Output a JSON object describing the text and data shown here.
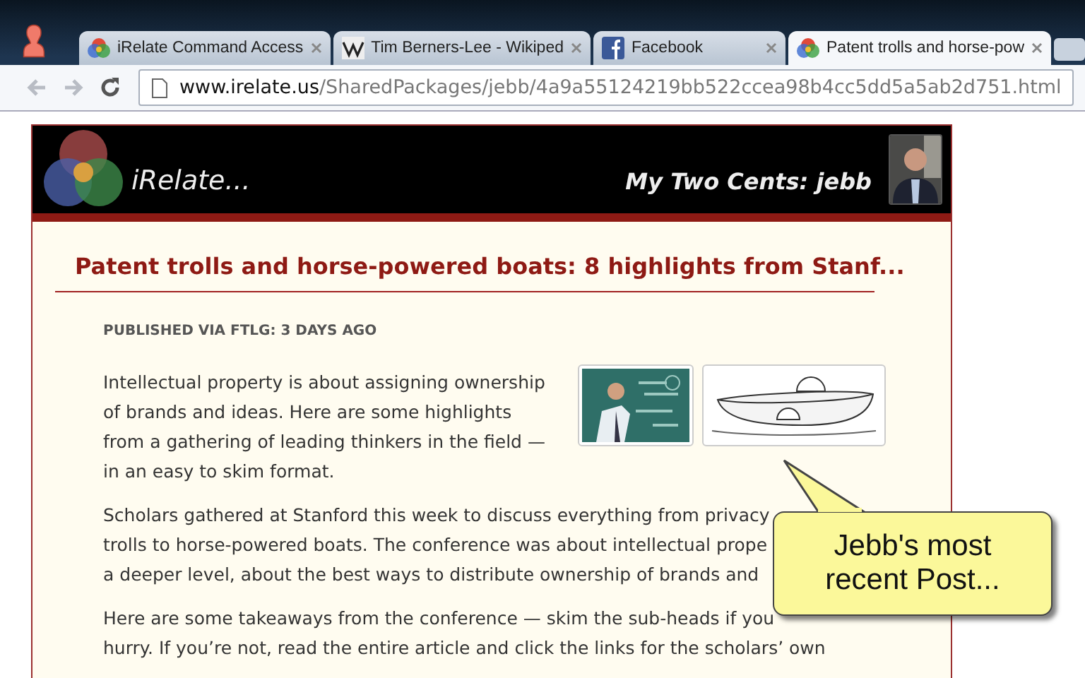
{
  "browser": {
    "tabs": [
      {
        "title": "iRelate Command Access",
        "kind": "circles",
        "selected": false
      },
      {
        "title": "Tim Berners-Lee - Wikiped",
        "kind": "wiki",
        "selected": false
      },
      {
        "title": "Facebook",
        "kind": "facebook",
        "selected": false
      },
      {
        "title": "Patent trolls and horse-pow",
        "kind": "circles",
        "selected": true
      }
    ],
    "address": {
      "host": "www.irelate.us",
      "path": "/SharedPackages/jebb/4a9a55124219bb522ccea98b4cc5dd5a5ab2d751.html"
    }
  },
  "header": {
    "logo": "iRelate...",
    "byline": "My Two Cents: jebb"
  },
  "post": {
    "title": "Patent trolls and horse-powered boats: 8 highlights from Stanf...",
    "meta": "PUBLISHED VIA FTLG: 3 DAYS AGO",
    "paragraphs": [
      [
        "Intellectual property is about assigning ownership",
        "of brands and ideas. Here are some highlights",
        "from a gathering of leading thinkers in the field —",
        "in an easy to skim format."
      ],
      [
        "Scholars gathered at Stanford this week to discuss everything from privacy",
        "trolls to horse-powered boats. The conference was about intellectual prope",
        "a deeper level, about the best ways to distribute ownership of brands and"
      ],
      [
        "Here are some takeaways from the conference — skim the sub-heads if you",
        "hurry. If you’re not, read the entire article and click the links for the scholars’ own"
      ]
    ]
  },
  "callout": {
    "text": "Jebb's most recent Post..."
  }
}
